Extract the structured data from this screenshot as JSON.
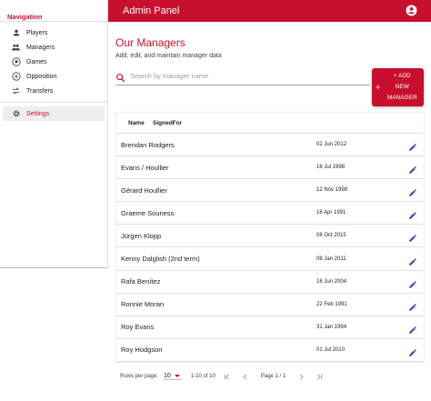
{
  "sidebar": {
    "header": "Navigation",
    "items": [
      {
        "label": "Players",
        "icon": "person-icon"
      },
      {
        "label": "Managers",
        "icon": "people-icon"
      },
      {
        "label": "Games",
        "icon": "soccer-ball-icon"
      },
      {
        "label": "Opposition",
        "icon": "shield-icon"
      },
      {
        "label": "Transfers",
        "icon": "swap-icon"
      }
    ],
    "settings": {
      "label": "Settings",
      "icon": "gear-icon"
    }
  },
  "topbar": {
    "title": "Admin Panel",
    "account_icon": "account-circle-icon"
  },
  "main": {
    "title": "Our Managers",
    "subtitle": "Add, edit, and maintain manager data",
    "search": {
      "placeholder": "Search by manager name",
      "value": ""
    },
    "add_button": {
      "line1": "+ ADD",
      "line2": "NEW",
      "line3": "MANAGER"
    }
  },
  "table": {
    "columns": [
      "Name",
      "SignedFor"
    ],
    "rows": [
      {
        "name": "Brendan Rodgers",
        "date": "01 Jun 2012"
      },
      {
        "name": "Evans / Houllier",
        "date": "16 Jul 1998"
      },
      {
        "name": "Gérard Houllier",
        "date": "12 Nov 1998"
      },
      {
        "name": "Graeme Souness",
        "date": "16 Apr 1991"
      },
      {
        "name": "Jürgen Klopp",
        "date": "08 Oct 2015"
      },
      {
        "name": "Kenny Dalglish (2nd term)",
        "date": "08 Jan 2011"
      },
      {
        "name": "Rafa Benítez",
        "date": "16 Jun 2004"
      },
      {
        "name": "Ronnie Moran",
        "date": "22 Feb 1991"
      },
      {
        "name": "Roy Evans",
        "date": "31 Jan 1994"
      },
      {
        "name": "Roy Hodgson",
        "date": "01 Jul 2010"
      }
    ]
  },
  "pagination": {
    "rows_per_page_label": "Rows per page:",
    "rows_per_page": "10",
    "range": "1-10 of 10",
    "page": "Page 1 / 1"
  },
  "colors": {
    "primary": "#c8102e",
    "edit": "#5e35b1"
  }
}
